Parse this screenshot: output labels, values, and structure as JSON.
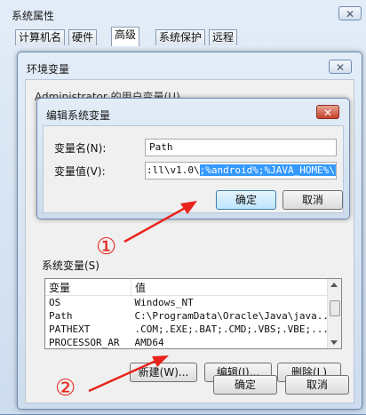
{
  "sys_props": {
    "title": "系统属性",
    "close": "✕",
    "tabs": [
      "计算机名",
      "硬件",
      "高级",
      "系统保护",
      "远程"
    ]
  },
  "env_dialog": {
    "title": "环境变量",
    "close": "✕",
    "user_vars_label": "Administrator 的用户变量(U)",
    "system_vars_label": "系统变量(S)",
    "columns": [
      "变量",
      "值"
    ],
    "rows": [
      {
        "name": "OS",
        "value": "Windows_NT"
      },
      {
        "name": "Path",
        "value": "C:\\ProgramData\\Oracle\\Java\\java..."
      },
      {
        "name": "PATHEXT",
        "value": ".COM;.EXE;.BAT;.CMD;.VBS;.VBE;...."
      },
      {
        "name": "PROCESSOR_AR",
        "value": "AMD64"
      }
    ],
    "new_button": "新建(W)...",
    "edit_button": "编辑(I)...",
    "delete_button": "删除(L)",
    "ok_button": "确定",
    "cancel_button": "取消"
  },
  "edit_dialog": {
    "title": "编辑系统变量",
    "close": "✕",
    "name_label": "变量名(N):",
    "name_value": "Path",
    "value_label": "变量值(V):",
    "value_plain": ":ll\\v1.0\\",
    "value_selected": ";%android%;%JAVA_HOME%\\bin",
    "ok_button": "确定",
    "cancel_button": "取消"
  },
  "annotations": {
    "marker_1": "①",
    "marker_2": "②",
    "color": "#e8241c"
  }
}
